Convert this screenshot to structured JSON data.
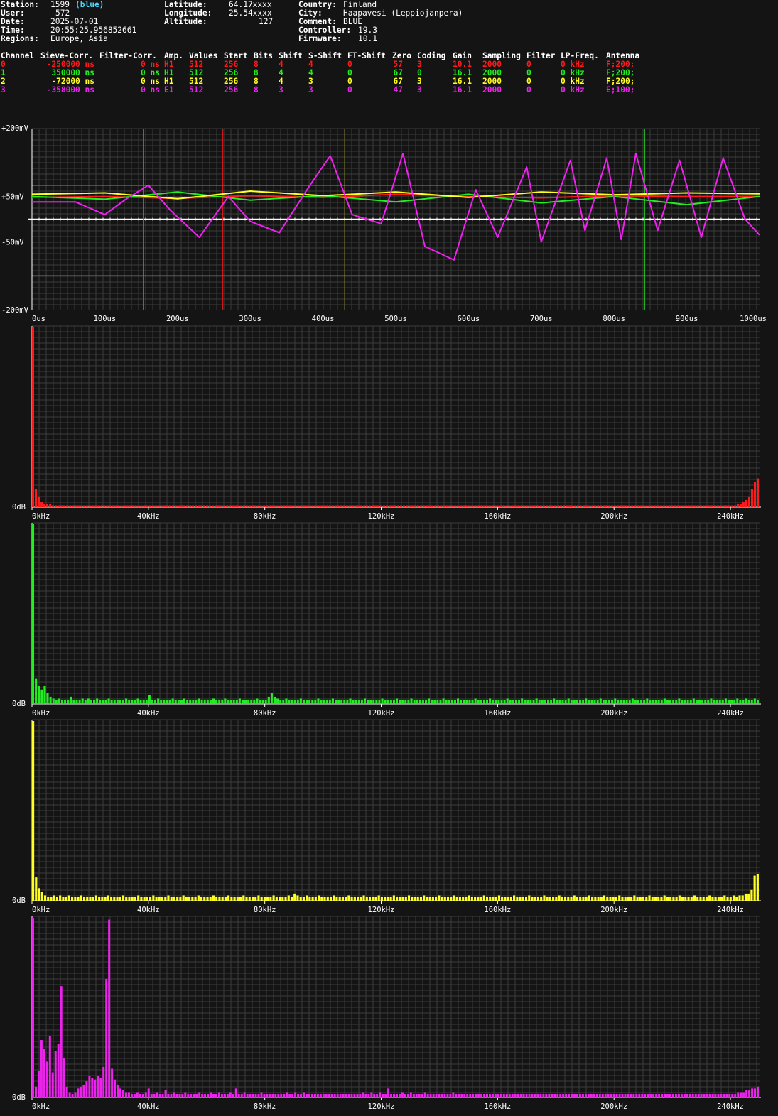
{
  "header": {
    "station_label": "Station:",
    "station": "1599",
    "station_color_name": "(blue)",
    "user_label": "User:",
    "user": "572",
    "date_label": "Date:",
    "date": "2025-07-01",
    "time_label": "Time:",
    "time": "20:55:25.956852661",
    "regions_label": "Regions:",
    "regions": "Europe, Asia",
    "latitude_label": "Latitude:",
    "latitude": "64.17xxxx",
    "longitude_label": "Longitude:",
    "longitude": "25.54xxxx",
    "altitude_label": "Altitude:",
    "altitude": "127",
    "country_label": "Country:",
    "country": "Finland",
    "city_label": "City:",
    "city": "Haapavesi (Leppiojanpera)",
    "comment_label": "Comment:",
    "comment": "BLUE",
    "controller_label": "Controller:",
    "controller": "19.3",
    "firmware_label": "Firmware:",
    "firmware": "10.1"
  },
  "channel_table": {
    "columns": [
      "Channel",
      "Sieve-Corr.",
      "Filter-Corr.",
      "Amp.",
      "Values",
      "Start",
      "Bits",
      "Shift",
      "S-Shift",
      "FT-Shift",
      "Zero",
      "Coding",
      "Gain",
      "Sampling",
      "Filter",
      "LP-Freq.",
      "Antenna"
    ],
    "rows": [
      {
        "color": "#ff1a1a",
        "cells": [
          "0",
          "-250000 ns",
          "0 ns",
          "H1",
          "512",
          "256",
          "8",
          "4",
          "4",
          "0",
          "57",
          "3",
          "10.1",
          "2000",
          "0",
          "0 kHz",
          "F;200;"
        ]
      },
      {
        "color": "#22ee22",
        "cells": [
          "1",
          "350000 ns",
          "0 ns",
          "H1",
          "512",
          "256",
          "8",
          "4",
          "4",
          "0",
          "67",
          "0",
          "16.1",
          "2000",
          "0",
          "0 kHz",
          "F;200;"
        ]
      },
      {
        "color": "#ffff22",
        "cells": [
          "2",
          "-72000 ns",
          "0 ns",
          "H1",
          "512",
          "256",
          "8",
          "4",
          "3",
          "0",
          "67",
          "3",
          "16.1",
          "2000",
          "0",
          "0 kHz",
          "F;200;"
        ]
      },
      {
        "color": "#ee22ee",
        "cells": [
          "3",
          "-358000 ns",
          "0 ns",
          "E1",
          "512",
          "256",
          "8",
          "3",
          "3",
          "0",
          "47",
          "3",
          "16.1",
          "2000",
          "0",
          "0 kHz",
          "E;100;"
        ]
      }
    ]
  },
  "chart_data": [
    {
      "type": "line",
      "x_unit": "us",
      "xlim": [
        0,
        1000
      ],
      "ylim": [
        -200,
        200
      ],
      "y_ticks": [
        "+200mV",
        "+50mV",
        "-50mV",
        "-200mV"
      ],
      "y_tick_values": [
        200,
        50,
        -50,
        -200
      ],
      "x_ticks": [
        "0us",
        "100us",
        "200us",
        "300us",
        "400us",
        "500us",
        "600us",
        "700us",
        "800us",
        "900us",
        "1000us"
      ],
      "x_tick_values": [
        0,
        100,
        200,
        300,
        400,
        500,
        600,
        700,
        800,
        900,
        1000
      ],
      "grid": true,
      "reference_lines_mV": [
        75,
        -125
      ],
      "marker_lines": [
        {
          "x": 153,
          "color": "#ee22ee"
        },
        {
          "x": 262,
          "color": "#ff1a1a"
        },
        {
          "x": 430,
          "color": "#ffff22"
        },
        {
          "x": 842,
          "color": "#22ee22"
        }
      ],
      "series": [
        {
          "color": "#ff1a1a",
          "x": [
            0,
            100,
            200,
            300,
            400,
            500,
            600,
            700,
            800,
            900,
            1000
          ],
          "values": [
            48,
            50,
            46,
            52,
            48,
            55,
            50,
            47,
            52,
            50,
            50
          ]
        },
        {
          "color": "#22ee22",
          "x": [
            0,
            100,
            200,
            300,
            400,
            500,
            600,
            700,
            800,
            900,
            1000
          ],
          "values": [
            50,
            44,
            60,
            42,
            52,
            38,
            55,
            36,
            50,
            32,
            50
          ]
        },
        {
          "color": "#ffff22",
          "x": [
            0,
            100,
            200,
            300,
            400,
            500,
            600,
            700,
            800,
            900,
            1000
          ],
          "values": [
            55,
            58,
            45,
            62,
            52,
            60,
            48,
            60,
            54,
            58,
            56
          ]
        },
        {
          "color": "#ee22ee",
          "x": [
            0,
            60,
            100,
            130,
            160,
            190,
            230,
            270,
            300,
            340,
            380,
            410,
            440,
            480,
            510,
            540,
            580,
            610,
            640,
            680,
            700,
            740,
            760,
            790,
            810,
            830,
            860,
            890,
            920,
            950,
            980,
            1000
          ],
          "values": [
            38,
            38,
            10,
            45,
            75,
            20,
            -40,
            50,
            -5,
            -30,
            70,
            140,
            10,
            -10,
            145,
            -60,
            -90,
            65,
            -40,
            115,
            -50,
            130,
            -25,
            135,
            -45,
            145,
            -25,
            130,
            -40,
            135,
            0,
            -35
          ]
        }
      ]
    },
    {
      "type": "bar",
      "color": "#ff1a1a",
      "x_unit": "kHz",
      "xlim": [
        0,
        250
      ],
      "ylabel": "0dB",
      "x_ticks": [
        "0kHz",
        "40kHz",
        "80kHz",
        "120kHz",
        "160kHz",
        "200kHz",
        "240kHz"
      ],
      "x_tick_values": [
        0,
        40,
        80,
        120,
        160,
        200,
        240
      ],
      "values": [
        100,
        10,
        6,
        3,
        2,
        2,
        2,
        1,
        1,
        1,
        1,
        1,
        1,
        1,
        1,
        1,
        1,
        1,
        1,
        1,
        1,
        1,
        1,
        1,
        1,
        1,
        1,
        1,
        1,
        1,
        1,
        1,
        1,
        1,
        1,
        1,
        1,
        1,
        1,
        1,
        1,
        1,
        1,
        1,
        1,
        1,
        1,
        1,
        1,
        1,
        1,
        1,
        1,
        1,
        1,
        1,
        1,
        1,
        1,
        1,
        1,
        1,
        1,
        1,
        1,
        1,
        1,
        1,
        1,
        1,
        1,
        1,
        1,
        1,
        1,
        1,
        1,
        1,
        1,
        1,
        1,
        1,
        1,
        1,
        1,
        1,
        1,
        1,
        1,
        1,
        1,
        1,
        1,
        1,
        1,
        1,
        1,
        1,
        1,
        1,
        1,
        1,
        1,
        1,
        1,
        1,
        1,
        1,
        1,
        1,
        1,
        1,
        1,
        1,
        1,
        1,
        1,
        1,
        1,
        1,
        1,
        1,
        1,
        1,
        1,
        1,
        1,
        1,
        1,
        1,
        1,
        1,
        1,
        1,
        1,
        1,
        1,
        1,
        1,
        1,
        1,
        1,
        1,
        1,
        1,
        1,
        1,
        1,
        1,
        1,
        1,
        1,
        1,
        1,
        1,
        1,
        1,
        1,
        1,
        1,
        1,
        1,
        1,
        1,
        1,
        1,
        1,
        1,
        1,
        1,
        1,
        1,
        1,
        1,
        1,
        1,
        1,
        1,
        1,
        1,
        1,
        1,
        1,
        1,
        1,
        1,
        1,
        1,
        1,
        1,
        1,
        1,
        1,
        1,
        1,
        1,
        1,
        1,
        1,
        1,
        1,
        1,
        1,
        1,
        1,
        1,
        1,
        1,
        1,
        1,
        1,
        1,
        1,
        1,
        1,
        1,
        1,
        1,
        1,
        1,
        1,
        1,
        1,
        1,
        1,
        1,
        1,
        1,
        1,
        1,
        1,
        1,
        1,
        1,
        1,
        1,
        1,
        1,
        1,
        1,
        1,
        1,
        1,
        1,
        1,
        1,
        1,
        2,
        2,
        3,
        4,
        6,
        10,
        14,
        16
      ]
    },
    {
      "type": "bar",
      "color": "#22ee22",
      "x_unit": "kHz",
      "xlim": [
        0,
        250
      ],
      "ylabel": "0dB",
      "x_ticks": [
        "0kHz",
        "40kHz",
        "80kHz",
        "120kHz",
        "160kHz",
        "200kHz",
        "240kHz"
      ],
      "x_tick_values": [
        0,
        40,
        80,
        120,
        160,
        200,
        240
      ],
      "values": [
        100,
        14,
        10,
        8,
        10,
        6,
        4,
        3,
        2,
        3,
        2,
        2,
        2,
        4,
        2,
        2,
        2,
        3,
        2,
        3,
        2,
        2,
        3,
        2,
        2,
        2,
        3,
        2,
        2,
        2,
        2,
        2,
        3,
        2,
        2,
        2,
        3,
        2,
        2,
        2,
        5,
        2,
        2,
        3,
        2,
        2,
        2,
        2,
        3,
        2,
        2,
        2,
        3,
        2,
        2,
        2,
        2,
        3,
        2,
        2,
        2,
        2,
        3,
        2,
        2,
        2,
        3,
        2,
        2,
        2,
        2,
        3,
        2,
        2,
        2,
        2,
        2,
        3,
        2,
        2,
        2,
        4,
        6,
        4,
        3,
        2,
        2,
        3,
        2,
        2,
        2,
        2,
        3,
        2,
        2,
        2,
        2,
        2,
        3,
        2,
        2,
        2,
        2,
        3,
        2,
        2,
        2,
        2,
        2,
        3,
        2,
        2,
        2,
        2,
        3,
        2,
        2,
        2,
        2,
        2,
        3,
        2,
        2,
        2,
        2,
        3,
        2,
        2,
        2,
        2,
        3,
        2,
        2,
        2,
        2,
        2,
        3,
        2,
        2,
        2,
        2,
        3,
        2,
        2,
        2,
        2,
        3,
        2,
        2,
        2,
        2,
        2,
        3,
        2,
        2,
        2,
        2,
        3,
        2,
        2,
        2,
        2,
        2,
        3,
        2,
        2,
        2,
        2,
        3,
        2,
        2,
        2,
        2,
        3,
        2,
        2,
        2,
        2,
        2,
        3,
        2,
        2,
        2,
        2,
        3,
        2,
        2,
        2,
        2,
        2,
        3,
        2,
        2,
        2,
        2,
        3,
        2,
        2,
        2,
        2,
        3,
        2,
        2,
        2,
        2,
        2,
        3,
        2,
        2,
        2,
        2,
        3,
        2,
        2,
        2,
        2,
        2,
        3,
        2,
        2,
        2,
        2,
        3,
        2,
        2,
        2,
        2,
        3,
        2,
        2,
        2,
        2,
        2,
        3,
        2,
        2,
        2,
        2,
        3,
        2,
        2,
        2,
        3,
        2,
        2,
        3,
        2,
        2,
        3,
        2
      ]
    },
    {
      "type": "bar",
      "color": "#ffff22",
      "x_unit": "kHz",
      "xlim": [
        0,
        250
      ],
      "ylabel": "0dB",
      "x_ticks": [
        "0kHz",
        "40kHz",
        "80kHz",
        "120kHz",
        "160kHz",
        "200kHz",
        "240kHz"
      ],
      "x_tick_values": [
        0,
        40,
        80,
        120,
        160,
        200,
        240
      ],
      "values": [
        100,
        13,
        7,
        5,
        3,
        2,
        2,
        3,
        2,
        3,
        2,
        2,
        3,
        2,
        2,
        2,
        3,
        2,
        2,
        2,
        2,
        3,
        2,
        2,
        2,
        3,
        2,
        2,
        2,
        2,
        3,
        2,
        2,
        2,
        2,
        3,
        2,
        2,
        2,
        2,
        3,
        2,
        2,
        2,
        2,
        3,
        2,
        2,
        2,
        2,
        3,
        2,
        2,
        2,
        2,
        3,
        2,
        2,
        2,
        2,
        3,
        2,
        2,
        2,
        2,
        3,
        2,
        2,
        2,
        2,
        3,
        2,
        2,
        2,
        2,
        3,
        2,
        2,
        2,
        2,
        3,
        2,
        2,
        2,
        2,
        3,
        2,
        4,
        3,
        2,
        2,
        3,
        2,
        2,
        2,
        3,
        2,
        2,
        2,
        2,
        3,
        2,
        2,
        2,
        2,
        3,
        2,
        2,
        2,
        2,
        3,
        2,
        2,
        2,
        2,
        3,
        2,
        2,
        2,
        2,
        3,
        2,
        2,
        2,
        2,
        3,
        2,
        2,
        2,
        2,
        3,
        2,
        2,
        2,
        2,
        3,
        2,
        2,
        2,
        2,
        3,
        2,
        2,
        2,
        2,
        3,
        2,
        2,
        2,
        2,
        3,
        2,
        2,
        2,
        2,
        3,
        2,
        2,
        2,
        2,
        3,
        2,
        2,
        2,
        2,
        3,
        2,
        2,
        2,
        2,
        3,
        2,
        2,
        2,
        2,
        3,
        2,
        2,
        2,
        2,
        3,
        2,
        2,
        2,
        2,
        3,
        2,
        2,
        2,
        2,
        3,
        2,
        2,
        2,
        2,
        3,
        2,
        2,
        2,
        2,
        3,
        2,
        2,
        2,
        2,
        3,
        2,
        2,
        2,
        2,
        3,
        2,
        2,
        2,
        2,
        3,
        2,
        2,
        2,
        2,
        3,
        2,
        2,
        2,
        2,
        3,
        2,
        2,
        2,
        2,
        3,
        2,
        2,
        3,
        2,
        3,
        3,
        4,
        4,
        6,
        14,
        15
      ]
    },
    {
      "type": "bar",
      "color": "#ee22ee",
      "x_unit": "kHz",
      "xlim": [
        0,
        250
      ],
      "ylabel": "0dB",
      "x_ticks": [
        "0kHz",
        "40kHz",
        "80kHz",
        "120kHz",
        "160kHz",
        "200kHz",
        "240kHz"
      ],
      "x_tick_values": [
        0,
        40,
        80,
        120,
        160,
        200,
        240
      ],
      "values": [
        100,
        6,
        15,
        32,
        27,
        20,
        34,
        14,
        26,
        30,
        62,
        22,
        6,
        3,
        2,
        3,
        5,
        6,
        7,
        9,
        12,
        11,
        10,
        12,
        11,
        17,
        66,
        99,
        16,
        10,
        7,
        5,
        4,
        3,
        3,
        2,
        2,
        3,
        2,
        2,
        3,
        5,
        2,
        2,
        3,
        2,
        2,
        4,
        2,
        2,
        3,
        2,
        2,
        2,
        3,
        2,
        2,
        2,
        2,
        3,
        2,
        2,
        2,
        3,
        2,
        2,
        3,
        2,
        2,
        2,
        3,
        2,
        5,
        2,
        2,
        3,
        2,
        2,
        2,
        2,
        2,
        3,
        2,
        2,
        2,
        2,
        2,
        2,
        2,
        2,
        3,
        2,
        2,
        3,
        2,
        2,
        3,
        2,
        2,
        2,
        2,
        2,
        2,
        2,
        2,
        2,
        2,
        2,
        2,
        2,
        2,
        2,
        2,
        2,
        2,
        2,
        2,
        3,
        2,
        2,
        3,
        2,
        2,
        3,
        2,
        2,
        5,
        2,
        2,
        2,
        2,
        3,
        2,
        2,
        3,
        2,
        2,
        2,
        2,
        3,
        2,
        2,
        2,
        2,
        2,
        2,
        2,
        2,
        2,
        3,
        2,
        2,
        2,
        2,
        2,
        2,
        2,
        2,
        2,
        2,
        2,
        2,
        2,
        2,
        2,
        2,
        2,
        2,
        2,
        2,
        2,
        2,
        2,
        2,
        2,
        2,
        2,
        2,
        2,
        2,
        2,
        2,
        2,
        2,
        2,
        2,
        2,
        2,
        2,
        2,
        2,
        2,
        2,
        2,
        2,
        2,
        2,
        2,
        2,
        2,
        2,
        2,
        2,
        2,
        2,
        2,
        2,
        2,
        2,
        2,
        2,
        2,
        2,
        2,
        2,
        2,
        2,
        2,
        2,
        2,
        2,
        2,
        2,
        2,
        2,
        2,
        2,
        2,
        2,
        2,
        2,
        2,
        2,
        2,
        2,
        2,
        2,
        2,
        2,
        2,
        2,
        2,
        2,
        2,
        2,
        2,
        2,
        2,
        2,
        2,
        3,
        3,
        3,
        4,
        4,
        5,
        5,
        6
      ]
    }
  ]
}
